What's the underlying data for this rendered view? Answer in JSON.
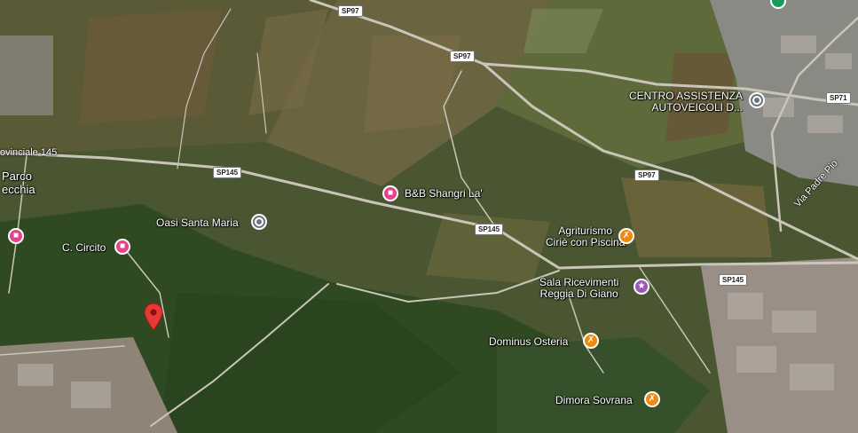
{
  "map": {
    "type": "satellite",
    "roads": {
      "sp97_top": "SP97",
      "sp97_mid": "SP97",
      "sp97_right": "SP97",
      "sp71": "SP71",
      "sp145_left": "SP145",
      "sp145_mid": "SP145",
      "sp145_right": "SP145",
      "provinciale": "ovinciale 145",
      "via_padre_pio": "Via Padre Pio"
    },
    "places": {
      "centro_line1": "CENTRO ASSISTENZA",
      "centro_line2": "AUTOVEICOLI D...",
      "bb": "B&B Shangri La'",
      "oasi": "Oasi Santa Maria",
      "circito": "C. Circito",
      "parco_line1": "Parco",
      "parco_line2": "ecchia",
      "agri_line1": "Agriturismo",
      "agri_line2": "Ciriè con Piscina",
      "sala_line1": "Sala Ricevimenti",
      "sala_line2": "Reggia Di Giano",
      "dominus": "Dominus Osteria",
      "dimora": "Dimora Sovrana"
    },
    "colors": {
      "hotel": "#e4448b",
      "restaurant": "#ee8a12",
      "event": "#9b58b6",
      "generic": "#6b7680",
      "marker": "#e53935"
    },
    "icons": [
      "hotel-icon",
      "restaurant-icon",
      "event-venue-icon",
      "place-icon",
      "location-marker-icon"
    ]
  }
}
